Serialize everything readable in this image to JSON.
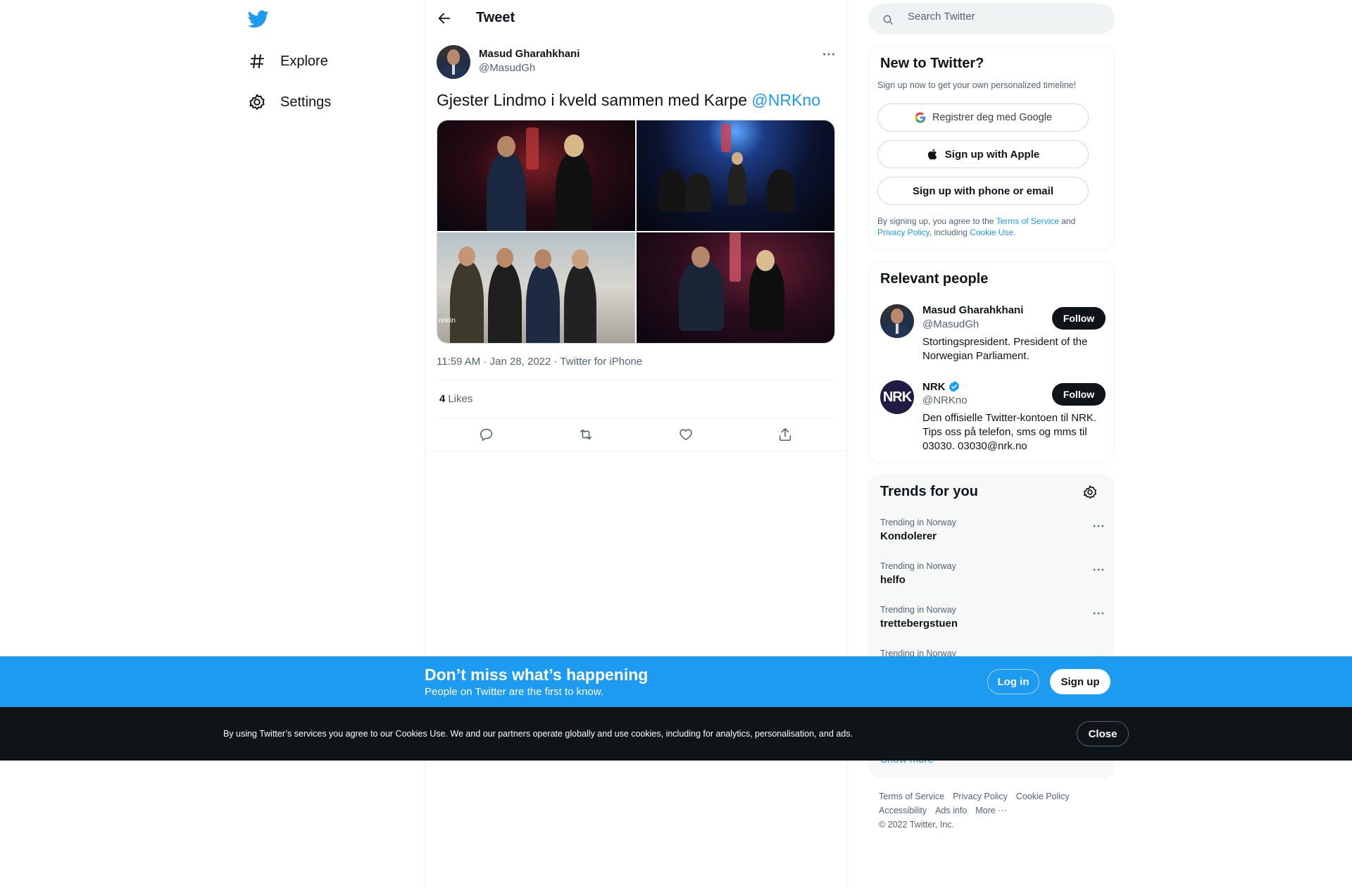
{
  "left_nav": {
    "logo": "twitter-bird-icon",
    "items": [
      {
        "label": "Explore",
        "icon": "hashtag-icon"
      },
      {
        "label": "Settings",
        "icon": "gear-icon"
      }
    ]
  },
  "tweet": {
    "header_title": "Tweet",
    "author_name": "Masud Gharahkhani",
    "author_handle": "@MasudGh",
    "text": "Gjester Lindmo i kveld sammen med Karpe ",
    "mention": "@NRKno",
    "photo_caption": "nrklin",
    "time": "11:59 AM",
    "date": "Jan 28, 2022",
    "source": "Twitter for iPhone",
    "meta_separator": " · ",
    "likes_count": "4",
    "likes_label": "Likes"
  },
  "search": {
    "placeholder": "Search Twitter"
  },
  "new_to_twitter": {
    "title": "New to Twitter?",
    "subtitle": "Sign up now to get your own personalized timeline!",
    "google_label": "Registrer deg med Google",
    "apple_label": "Sign up with Apple",
    "phone_label": "Sign up with phone or email",
    "legal_prefix": "By signing up, you agree to the ",
    "terms_link": "Terms of Service",
    "legal_and": " and ",
    "privacy_link": "Privacy Policy",
    "legal_including": ", including ",
    "cookie_link": "Cookie Use."
  },
  "relevant_people": {
    "title": "Relevant people",
    "people": [
      {
        "name": "Masud Gharahkhani",
        "handle": "@MasudGh",
        "bio": "Stortingspresident. President of the Norwegian Parliament.",
        "follow_label": "Follow"
      },
      {
        "name": "NRK",
        "handle": "@NRKno",
        "bio": "Den offisielle Twitter-kontoen til NRK. Tips oss på telefon, sms og mms til 03030. 03030@nrk.no",
        "follow_label": "Follow",
        "avatar_text": "NRK"
      }
    ]
  },
  "trends": {
    "title": "Trends for you",
    "items": [
      {
        "context": "Trending in Norway",
        "name": "Kondolerer"
      },
      {
        "context": "Trending in Norway",
        "name": "helfo"
      },
      {
        "context": "Trending in Norway",
        "name": "trettebergstuen"
      },
      {
        "context": "Trending in Norway",
        "name": ""
      }
    ],
    "show_more": "Show more"
  },
  "footer": {
    "links": [
      "Terms of Service",
      "Privacy Policy",
      "Cookie Policy",
      "Accessibility",
      "Ads info",
      "More ···"
    ],
    "copyright": "© 2022 Twitter, Inc."
  },
  "signup_bar": {
    "title": "Don’t miss what’s happening",
    "subtitle": "People on Twitter are the first to know.",
    "login_label": "Log in",
    "signup_label": "Sign up"
  },
  "cookie_bar": {
    "text": "By using Twitter’s services you agree to our Cookies Use. We and our partners operate globally and use cookies, including for analytics, personalisation, and ads.",
    "close_label": "Close"
  },
  "colors": {
    "accent": "#1d9bf0",
    "text": "#0f1419",
    "secondary_text": "#536471",
    "cookie_bar_bg": "#0f1419"
  }
}
